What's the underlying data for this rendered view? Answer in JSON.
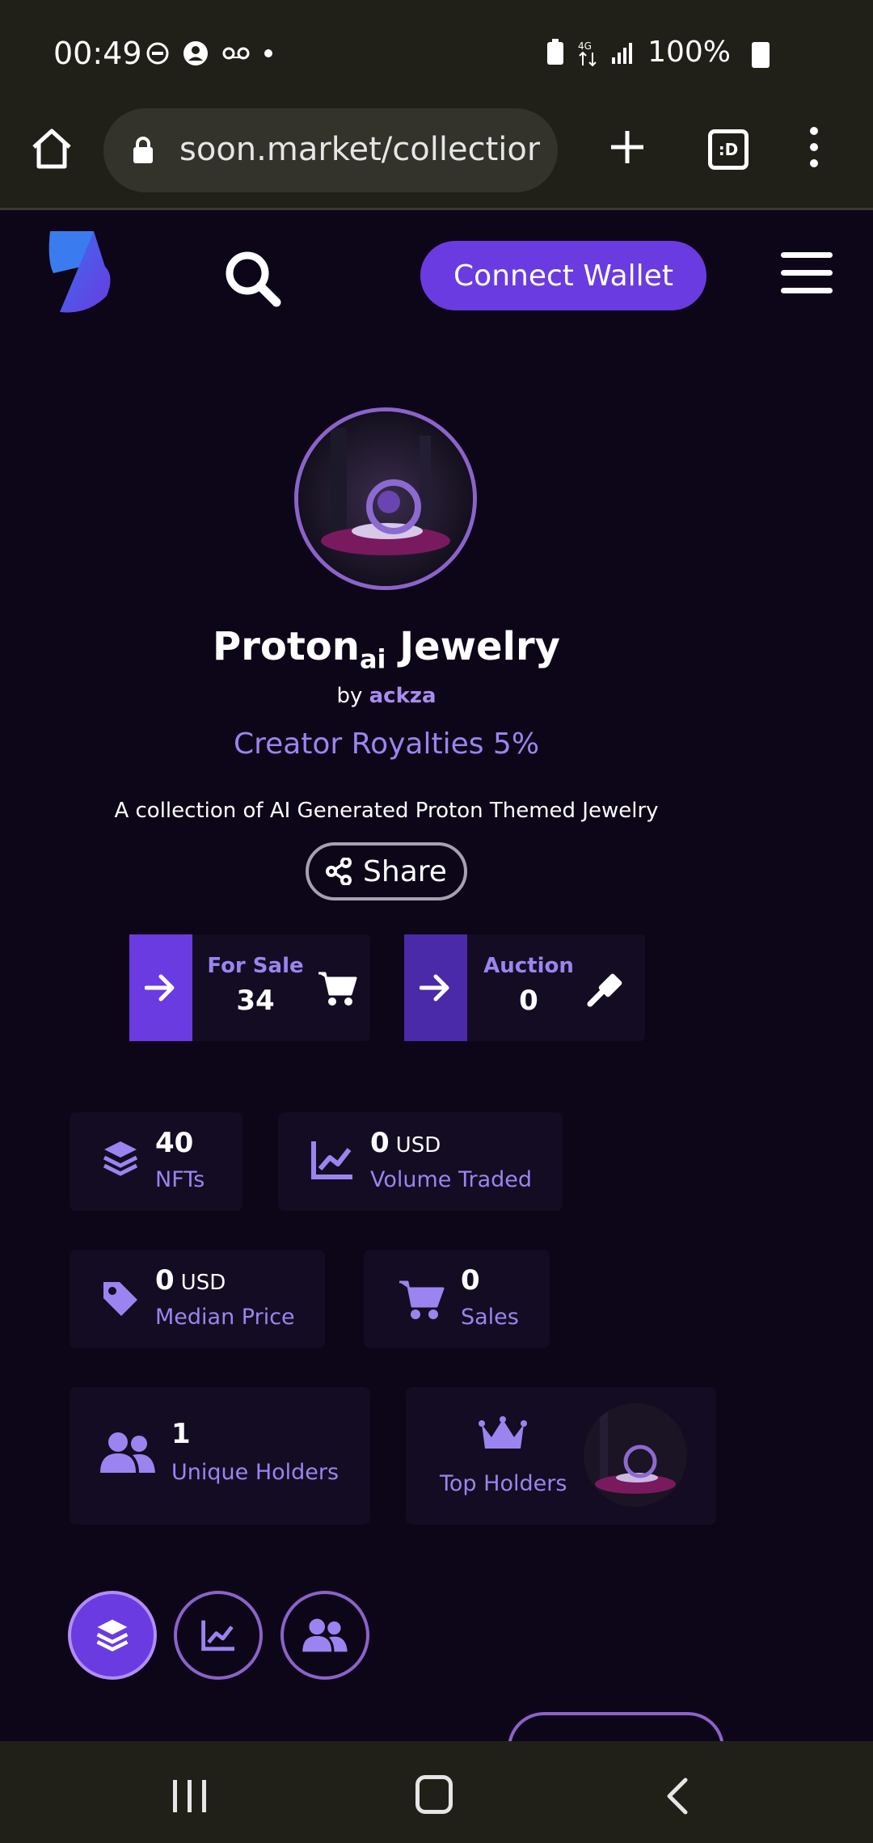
{
  "status_bar": {
    "time": "00:49",
    "battery": "100%"
  },
  "browser": {
    "url": "soon.market/collections",
    "tabs_label": ":D"
  },
  "header": {
    "connect_wallet": "Connect Wallet"
  },
  "collection": {
    "title_main": "Proton",
    "title_sub": "ai",
    "title_rest": " Jewelry",
    "by_label": "by",
    "creator": "ackza",
    "royalties": "Creator Royalties 5%",
    "description": "A collection of AI Generated Proton Themed Jewelry",
    "share_label": "Share"
  },
  "sale": {
    "for_sale_label": "For Sale",
    "for_sale_value": "34",
    "auction_label": "Auction",
    "auction_value": "0"
  },
  "stats": {
    "nfts_value": "40",
    "nfts_label": "NFTs",
    "volume_value": "0",
    "volume_unit": "USD",
    "volume_label": "Volume Traded",
    "median_value": "0",
    "median_unit": "USD",
    "median_label": "Median Price",
    "sales_value": "0",
    "sales_label": "Sales",
    "holders_value": "1",
    "holders_label": "Unique Holders",
    "top_holders_label": "Top Holders"
  },
  "colors": {
    "accent": "#6a3be0",
    "accent_light": "#9b84f0",
    "background": "#0d0518"
  }
}
